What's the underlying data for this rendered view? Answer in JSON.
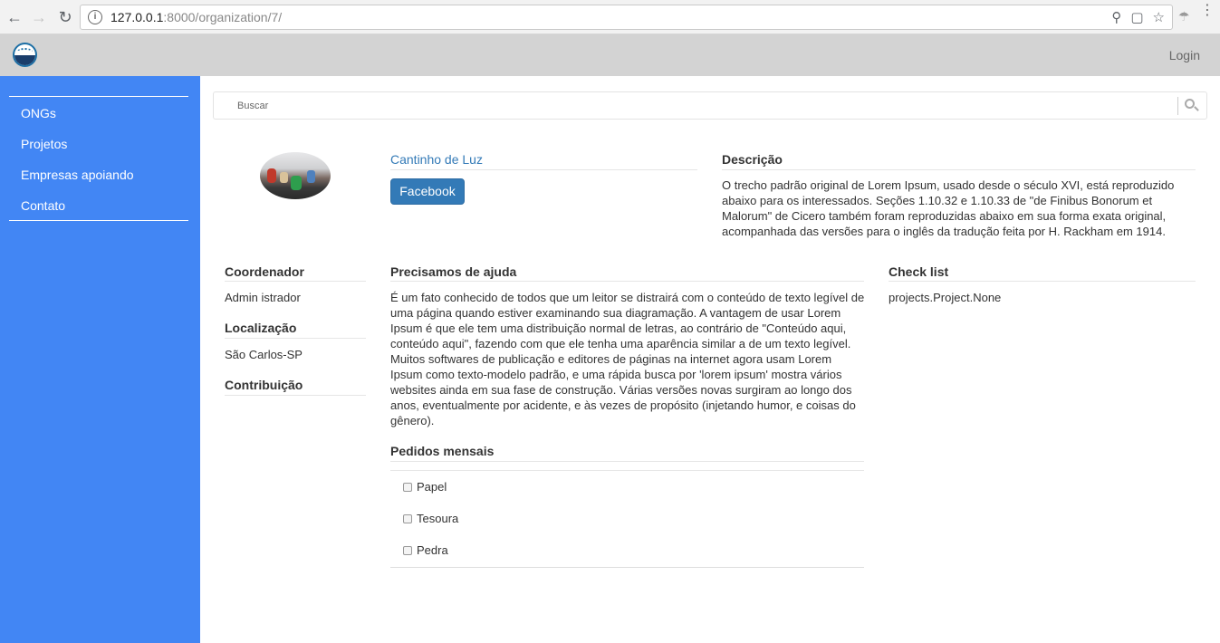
{
  "browser": {
    "url_host": "127.0.0.1",
    "url_path": ":8000/organization/7/"
  },
  "header": {
    "login_label": "Login"
  },
  "sidebar": {
    "items": [
      {
        "label": "ONGs"
      },
      {
        "label": "Projetos"
      },
      {
        "label": "Empresas apoiando"
      },
      {
        "label": "Contato"
      }
    ]
  },
  "search": {
    "placeholder": "Buscar"
  },
  "organization": {
    "name": "Cantinho de Luz",
    "facebook_label": "Facebook",
    "description_title": "Descrição",
    "description_text": "O trecho padrão original de Lorem Ipsum, usado desde o século XVI, está reproduzido abaixo para os interessados. Seções 1.10.32 e 1.10.33 de \"de Finibus Bonorum et Malorum\" de Cicero também foram reproduzidas abaixo em sua forma exata original, acompanhada das versões para o inglês da tradução feita por H. Rackham em 1914."
  },
  "info": {
    "coordinator_title": "Coordenador",
    "coordinator_value": "Admin istrador",
    "location_title": "Localização",
    "location_value": "São Carlos-SP",
    "contribution_title": "Contribuição"
  },
  "help": {
    "title": "Precisamos de ajuda",
    "text": "É um fato conhecido de todos que um leitor se distrairá com o conteúdo de texto legível de uma página quando estiver examinando sua diagramação. A vantagem de usar Lorem Ipsum é que ele tem uma distribuição normal de letras, ao contrário de \"Conteúdo aqui, conteúdo aqui\", fazendo com que ele tenha uma aparência similar a de um texto legível. Muitos softwares de publicação e editores de páginas na internet agora usam Lorem Ipsum como texto-modelo padrão, e uma rápida busca por 'lorem ipsum' mostra vários websites ainda em sua fase de construção. Várias versões novas surgiram ao longo dos anos, eventualmente por acidente, e às vezes de propósito (injetando humor, e coisas do gênero)."
  },
  "monthly": {
    "title": "Pedidos mensais",
    "items": [
      {
        "label": "Papel"
      },
      {
        "label": "Tesoura"
      },
      {
        "label": "Pedra"
      }
    ]
  },
  "checklist": {
    "title": "Check list",
    "value": "projects.Project.None"
  }
}
